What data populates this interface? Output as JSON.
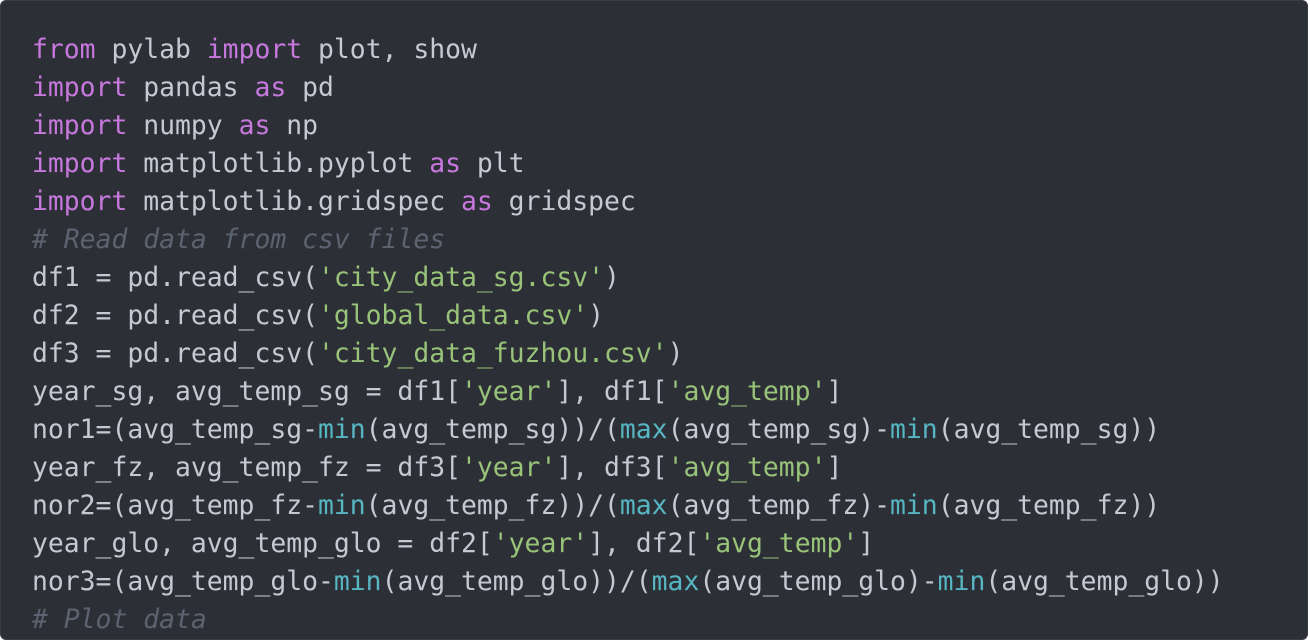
{
  "editor": {
    "lines": [
      [
        {
          "t": "from",
          "k": "kw"
        },
        {
          "t": " pylab ",
          "k": "tx"
        },
        {
          "t": "import",
          "k": "kw"
        },
        {
          "t": " plot, show",
          "k": "tx"
        }
      ],
      [
        {
          "t": "import",
          "k": "kw"
        },
        {
          "t": " pandas ",
          "k": "tx"
        },
        {
          "t": "as",
          "k": "kw"
        },
        {
          "t": " pd",
          "k": "tx"
        }
      ],
      [
        {
          "t": "import",
          "k": "kw"
        },
        {
          "t": " numpy ",
          "k": "tx"
        },
        {
          "t": "as",
          "k": "kw"
        },
        {
          "t": " np",
          "k": "tx"
        }
      ],
      [
        {
          "t": "import",
          "k": "kw"
        },
        {
          "t": " matplotlib.pyplot ",
          "k": "tx"
        },
        {
          "t": "as",
          "k": "kw"
        },
        {
          "t": " plt",
          "k": "tx"
        }
      ],
      [
        {
          "t": "import",
          "k": "kw"
        },
        {
          "t": " matplotlib.gridspec ",
          "k": "tx"
        },
        {
          "t": "as",
          "k": "kw"
        },
        {
          "t": " gridspec",
          "k": "tx"
        }
      ],
      [
        {
          "t": "# Read data from csv files",
          "k": "cm"
        }
      ],
      [
        {
          "t": "df1 = pd.read_csv(",
          "k": "tx"
        },
        {
          "t": "'city_data_sg.csv'",
          "k": "str"
        },
        {
          "t": ")",
          "k": "tx"
        }
      ],
      [
        {
          "t": "df2 = pd.read_csv(",
          "k": "tx"
        },
        {
          "t": "'global_data.csv'",
          "k": "str"
        },
        {
          "t": ")",
          "k": "tx"
        }
      ],
      [
        {
          "t": "df3 = pd.read_csv(",
          "k": "tx"
        },
        {
          "t": "'city_data_fuzhou.csv'",
          "k": "str"
        },
        {
          "t": ")",
          "k": "tx"
        }
      ],
      [
        {
          "t": "year_sg, avg_temp_sg = df1[",
          "k": "tx"
        },
        {
          "t": "'year'",
          "k": "str"
        },
        {
          "t": "], df1[",
          "k": "tx"
        },
        {
          "t": "'avg_temp'",
          "k": "str"
        },
        {
          "t": "]",
          "k": "tx"
        }
      ],
      [
        {
          "t": "nor1=(avg_temp_sg-",
          "k": "tx"
        },
        {
          "t": "min",
          "k": "fn"
        },
        {
          "t": "(avg_temp_sg))/(",
          "k": "tx"
        },
        {
          "t": "max",
          "k": "fn"
        },
        {
          "t": "(avg_temp_sg)-",
          "k": "tx"
        },
        {
          "t": "min",
          "k": "fn"
        },
        {
          "t": "(avg_temp_sg))",
          "k": "tx"
        }
      ],
      [
        {
          "t": "year_fz, avg_temp_fz = df3[",
          "k": "tx"
        },
        {
          "t": "'year'",
          "k": "str"
        },
        {
          "t": "], df3[",
          "k": "tx"
        },
        {
          "t": "'avg_temp'",
          "k": "str"
        },
        {
          "t": "]",
          "k": "tx"
        }
      ],
      [
        {
          "t": "nor2=(avg_temp_fz-",
          "k": "tx"
        },
        {
          "t": "min",
          "k": "fn"
        },
        {
          "t": "(avg_temp_fz))/(",
          "k": "tx"
        },
        {
          "t": "max",
          "k": "fn"
        },
        {
          "t": "(avg_temp_fz)-",
          "k": "tx"
        },
        {
          "t": "min",
          "k": "fn"
        },
        {
          "t": "(avg_temp_fz))",
          "k": "tx"
        }
      ],
      [
        {
          "t": "year_glo, avg_temp_glo = df2[",
          "k": "tx"
        },
        {
          "t": "'year'",
          "k": "str"
        },
        {
          "t": "], df2[",
          "k": "tx"
        },
        {
          "t": "'avg_temp'",
          "k": "str"
        },
        {
          "t": "]",
          "k": "tx"
        }
      ],
      [
        {
          "t": "nor3=(avg_temp_glo-",
          "k": "tx"
        },
        {
          "t": "min",
          "k": "fn"
        },
        {
          "t": "(avg_temp_glo))/(",
          "k": "tx"
        },
        {
          "t": "max",
          "k": "fn"
        },
        {
          "t": "(avg_temp_glo)-",
          "k": "tx"
        },
        {
          "t": "min",
          "k": "fn"
        },
        {
          "t": "(avg_temp_glo))",
          "k": "tx"
        }
      ],
      [
        {
          "t": "# Plot data",
          "k": "cm"
        }
      ]
    ]
  }
}
